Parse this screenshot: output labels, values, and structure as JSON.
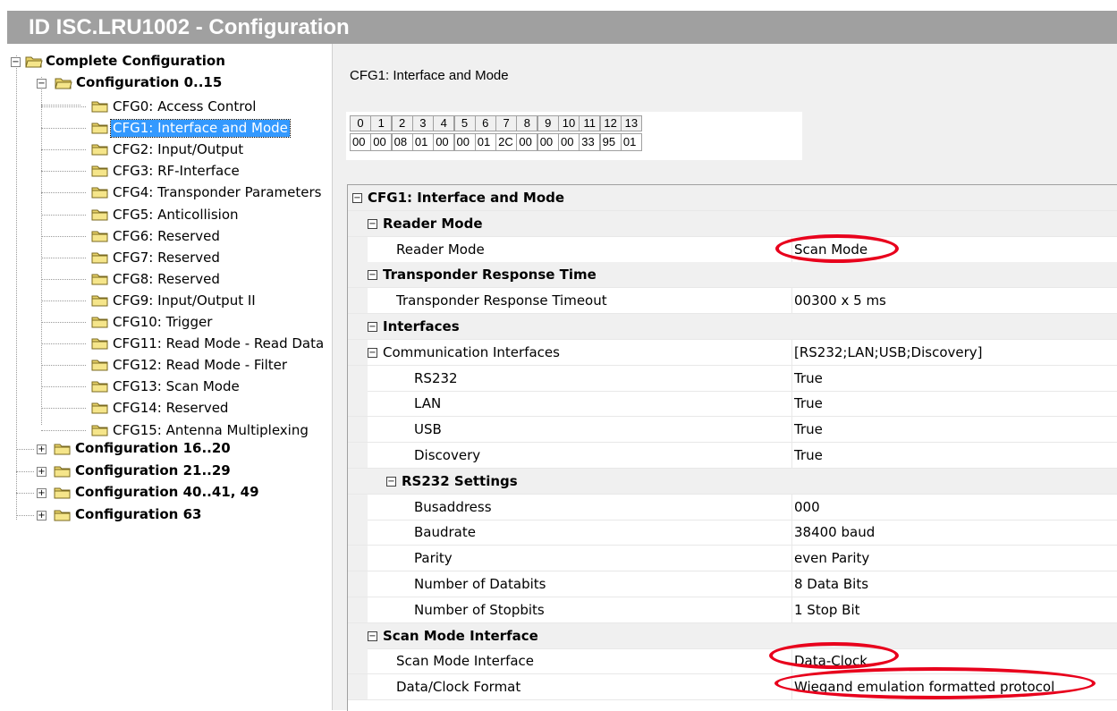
{
  "window": {
    "title": "ID ISC.LRU1002 - Configuration"
  },
  "tree": {
    "root": "Complete Configuration",
    "group_0_15": "Configuration 0..15",
    "items": [
      "CFG0: Access Control",
      "CFG1: Interface and Mode",
      "CFG2: Input/Output",
      "CFG3: RF-Interface",
      "CFG4: Transponder Parameters",
      "CFG5: Anticollision",
      "CFG6: Reserved",
      "CFG7: Reserved",
      "CFG8: Reserved",
      "CFG9: Input/Output II",
      "CFG10: Trigger",
      "CFG11: Read Mode - Read Data",
      "CFG12: Read Mode - Filter",
      "CFG13: Scan Mode",
      "CFG14: Reserved",
      "CFG15: Antenna Multiplexing"
    ],
    "selected_index": 1,
    "collapsed_groups": [
      "Configuration 16..20",
      "Configuration 21..29",
      "Configuration 40..41, 49",
      "Configuration 63"
    ],
    "expander_collapsed": "+",
    "expander_expanded": "−"
  },
  "main": {
    "heading": "CFG1: Interface and Mode",
    "hex_indices": [
      "0",
      "1",
      "2",
      "3",
      "4",
      "5",
      "6",
      "7",
      "8",
      "9",
      "10",
      "11",
      "12",
      "13"
    ],
    "hex_values": [
      "00",
      "00",
      "08",
      "01",
      "00",
      "00",
      "01",
      "2C",
      "00",
      "00",
      "00",
      "33",
      "95",
      "01"
    ]
  },
  "grid": {
    "root": "CFG1: Interface and Mode",
    "reader_mode_cat": "Reader Mode",
    "reader_mode_name": "Reader Mode",
    "reader_mode_val": "Scan Mode",
    "resp_cat": "Transponder Response Time",
    "resp_name": "Transponder Response Timeout",
    "resp_val": "00300 x 5 ms",
    "interfaces_cat": "Interfaces",
    "comm_name": "Communication Interfaces",
    "comm_val": "[RS232;LAN;USB;Discovery]",
    "rs232_name": "RS232",
    "rs232_val": "True",
    "lan_name": "LAN",
    "lan_val": "True",
    "usb_name": "USB",
    "usb_val": "True",
    "disc_name": "Discovery",
    "disc_val": "True",
    "rs232_settings_cat": "RS232 Settings",
    "busaddr_name": "Busaddress",
    "busaddr_val": "000",
    "baud_name": "Baudrate",
    "baud_val": "38400 baud",
    "parity_name": "Parity",
    "parity_val": "even Parity",
    "databits_name": "Number of Databits",
    "databits_val": "8 Data Bits",
    "stopbits_name": "Number of Stopbits",
    "stopbits_val": "1 Stop Bit",
    "scan_cat": "Scan Mode Interface",
    "scan_if_name": "Scan Mode Interface",
    "scan_if_val": "Data-Clock",
    "dc_format_name": "Data/Clock Format",
    "dc_format_val": "Wiegand emulation formatted protocol"
  },
  "colors": {
    "highlight_ellipse": "#e8001c",
    "selection": "#3399ff",
    "title_bg": "#a0a0a0"
  }
}
